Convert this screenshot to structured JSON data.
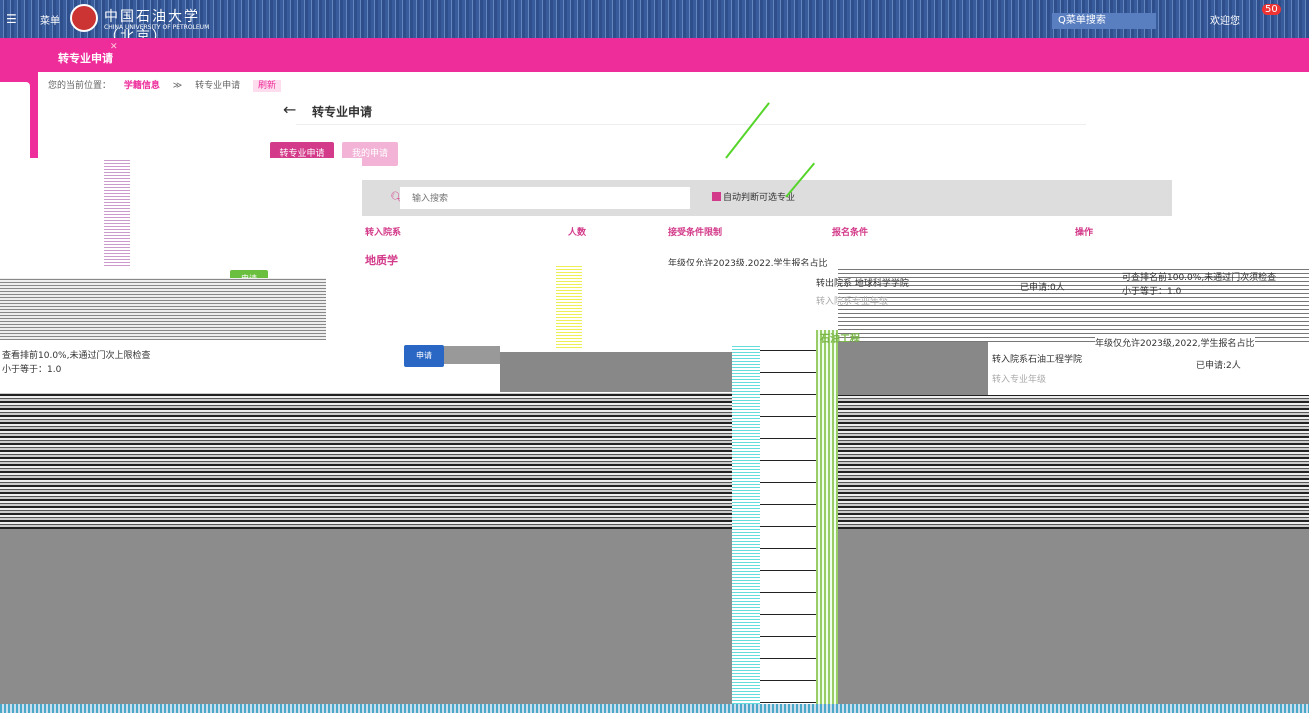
{
  "topbar": {
    "menu_label": "菜单",
    "logo_cn": "中国石油大学（北京）",
    "logo_en": "CHINA UNIVERSITY OF PETROLEUM",
    "search_label": "Q菜单搜索",
    "user_label": "欢迎您",
    "badge_count": "50"
  },
  "tab": {
    "label": "转专业申请",
    "close": "✕"
  },
  "breadcrumb": {
    "prefix": "您的当前位置：",
    "level1": "学籍信息",
    "sep": "≫",
    "level2": "转专业申请",
    "refresh": "刷新"
  },
  "page": {
    "back": "←",
    "title": "转专业申请"
  },
  "buttons": {
    "apply_tab": "转专业申请",
    "mine_tab": "我的申请",
    "apply_green": "申请",
    "apply_blue": "申请"
  },
  "search": {
    "icon": "search-icon",
    "placeholder": "输入搜索",
    "auto_label": "自动判断可选专业"
  },
  "table": {
    "headers": [
      "转入院系",
      "人数",
      "接受条件限制",
      "报名条件",
      "操作"
    ],
    "row1_dept": "地质学",
    "row1_limit": "年级仅允许2023级,2022,学生报名占比",
    "row_texts": {
      "college_a": "转出院系 地球科学学院",
      "applied_a": "已申请:0人",
      "rank_a": "可查排名前100.0%,未通过门次须检查",
      "lte_a": "小于等于：1.0",
      "major_a": "转入院系专业年级",
      "rank_b": "查看排前10.0%,未通过门次上限检查",
      "lte_b": "小于等于：1.0",
      "tag": "石油工程",
      "limit_b": "年级仅允许2023级,2022,学生报名占比",
      "college_b": "转入院系石油工程学院",
      "applied_b": "已申请:2人",
      "major_b": "转入专业年级"
    }
  }
}
